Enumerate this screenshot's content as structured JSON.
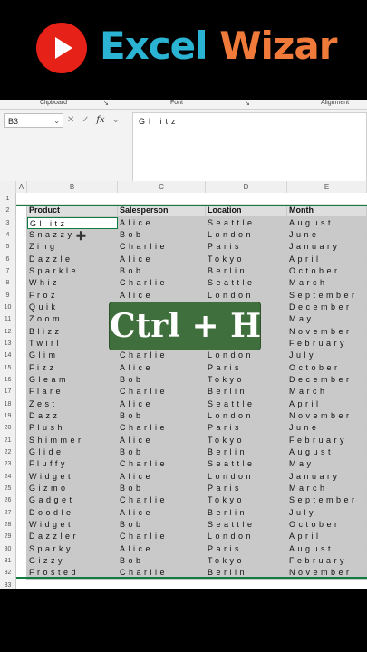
{
  "banner": {
    "title_part1": "Excel",
    "title_part2": "Wizar",
    "logo_icon": "youtube-play-icon"
  },
  "ribbon": {
    "groups": [
      "Clipboard",
      "Font",
      "Alignment"
    ],
    "launcher_glyph": "↘"
  },
  "formula_bar": {
    "name_box": "B3",
    "cancel_glyph": "✕",
    "enter_glyph": "✓",
    "fx_label": "fx",
    "dropdown_glyph": "⌄",
    "formula": "Gl itz"
  },
  "columns": [
    "A",
    "B",
    "C",
    "D",
    "E"
  ],
  "table": {
    "headers": [
      "Product",
      "Salesperson",
      "Location",
      "Month"
    ],
    "rows": [
      [
        "Gl itz",
        "Alice",
        "Seattle",
        "August"
      ],
      [
        "Snazzy",
        "Bob",
        "London",
        "June"
      ],
      [
        "Zing",
        "Charlie",
        "Paris",
        "January"
      ],
      [
        "Dazzle",
        "Alice",
        "Tokyo",
        "April"
      ],
      [
        "Sparkle",
        "Bob",
        "Berlin",
        "October"
      ],
      [
        "Whiz",
        "Charlie",
        "Seattle",
        "March"
      ],
      [
        "Froz",
        "Alice",
        "London",
        "September"
      ],
      [
        "Quik",
        "",
        "",
        "December"
      ],
      [
        "Zoom",
        "",
        "",
        "May"
      ],
      [
        "Blizz",
        "",
        "",
        "November"
      ],
      [
        "Twirl",
        "",
        "",
        "February"
      ],
      [
        "Glim",
        "Charlie",
        "London",
        "July"
      ],
      [
        "Fizz",
        "Alice",
        "Paris",
        "October"
      ],
      [
        "Gleam",
        "Bob",
        "Tokyo",
        "December"
      ],
      [
        "Flare",
        "Charlie",
        "Berlin",
        "March"
      ],
      [
        "Zest",
        "Alice",
        "Seattle",
        "April"
      ],
      [
        "Dazz",
        "Bob",
        "London",
        "November"
      ],
      [
        "Plush",
        "Charlie",
        "Paris",
        "June"
      ],
      [
        "Shimmer",
        "Alice",
        "Tokyo",
        "February"
      ],
      [
        "Glide",
        "Bob",
        "Berlin",
        "August"
      ],
      [
        "Fluffy",
        "Charlie",
        "Seattle",
        "May"
      ],
      [
        "Widget",
        "Alice",
        "London",
        "January"
      ],
      [
        "Gizmo",
        "Bob",
        "Paris",
        "March"
      ],
      [
        "Gadget",
        "Charlie",
        "Tokyo",
        "September"
      ],
      [
        "Doodle",
        "Alice",
        "Berlin",
        "July"
      ],
      [
        "Widget",
        "Bob",
        "Seattle",
        "October"
      ],
      [
        "Dazzler",
        "Charlie",
        "London",
        "April"
      ],
      [
        "Sparky",
        "Alice",
        "Paris",
        "August"
      ],
      [
        "Gizzy",
        "Bob",
        "Tokyo",
        "February"
      ],
      [
        "Frosted",
        "Charlie",
        "Berlin",
        "November"
      ]
    ]
  },
  "overlay": {
    "shortcut": "Ctrl + H"
  },
  "colors": {
    "selection": "#107c41",
    "overlay_bg": "#3f6f3c",
    "title_blue": "#2bb3d4",
    "title_orange": "#ef7a3a"
  }
}
